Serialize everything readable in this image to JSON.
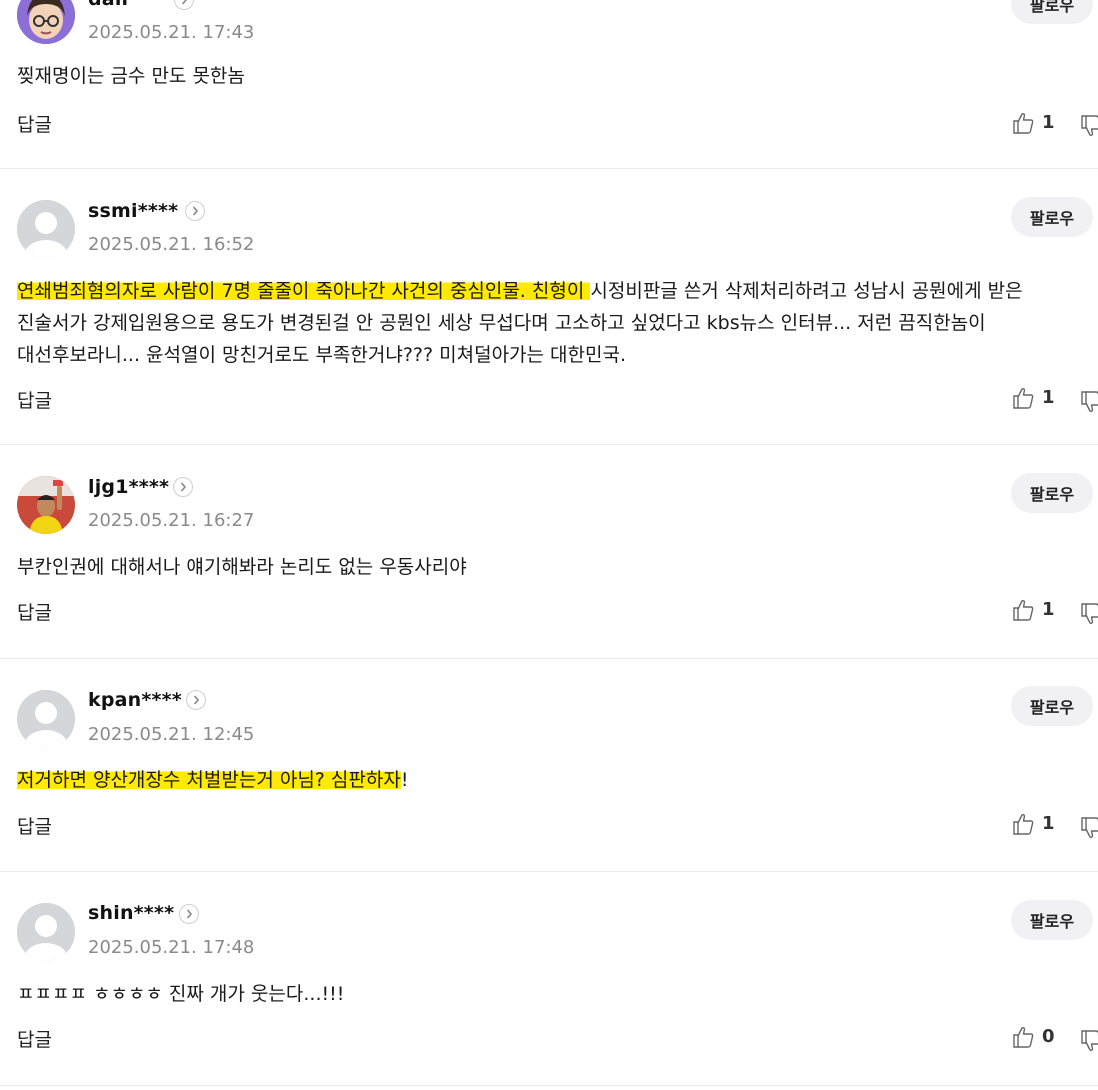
{
  "buttons": {
    "follow_label": "팔로우",
    "reply_label": "답글"
  },
  "comments": [
    {
      "username": "dall",
      "timestamp": "2025.05.21. 17:43",
      "text": "찢재명이는 금수 만도 못한놈",
      "likes": "1",
      "avatar": "cartoon-glasses-avatar"
    },
    {
      "username": "ssmi****",
      "timestamp": "2025.05.21. 16:52",
      "text_highlighted": "연쇄범죄혐의자로 사람이 7명 줄줄이 죽아나간 사건의 중심인물. 친형이 ",
      "text_rest": "시정비판글 쓴거 삭제처리하려고 성남시 공뭔에게 받은 진술서가 강제입원용으로 용도가 변경된걸 안 공뭔인 세상 무섭다며 고소하고 싶었다고 kbs뉴스 인터뷰... 저런 끔직한놈이 대선후보라니... 윤석열이 망친거로도 부족한거냐??? 미쳐덜아가는 대한민국.",
      "likes": "1",
      "avatar": "default-avatar"
    },
    {
      "username": "ljg1****",
      "timestamp": "2025.05.21. 16:27",
      "text": "부칸인권에 대해서나 얘기해봐라 논리도 없는 우동사리야",
      "likes": "1",
      "avatar": "photo-avatar"
    },
    {
      "username": "kpan****",
      "timestamp": "2025.05.21. 12:45",
      "text_highlighted": "저거하면 양산개장수 처벌받는거 아님? 심판하자",
      "text_rest": "!",
      "likes": "1",
      "avatar": "default-avatar"
    },
    {
      "username": "shin****",
      "timestamp": "2025.05.21. 17:48",
      "text": "ㅍㅍㅍㅍ ㅎㅎㅎㅎ 진짜 개가 웃는다...!!!",
      "likes": "0",
      "avatar": "default-avatar"
    }
  ],
  "colors": {
    "highlight": "#ffea00",
    "timestamp": "#8a8a8a",
    "follow_button_bg": "#f1f1f3",
    "divider": "#ececec"
  }
}
